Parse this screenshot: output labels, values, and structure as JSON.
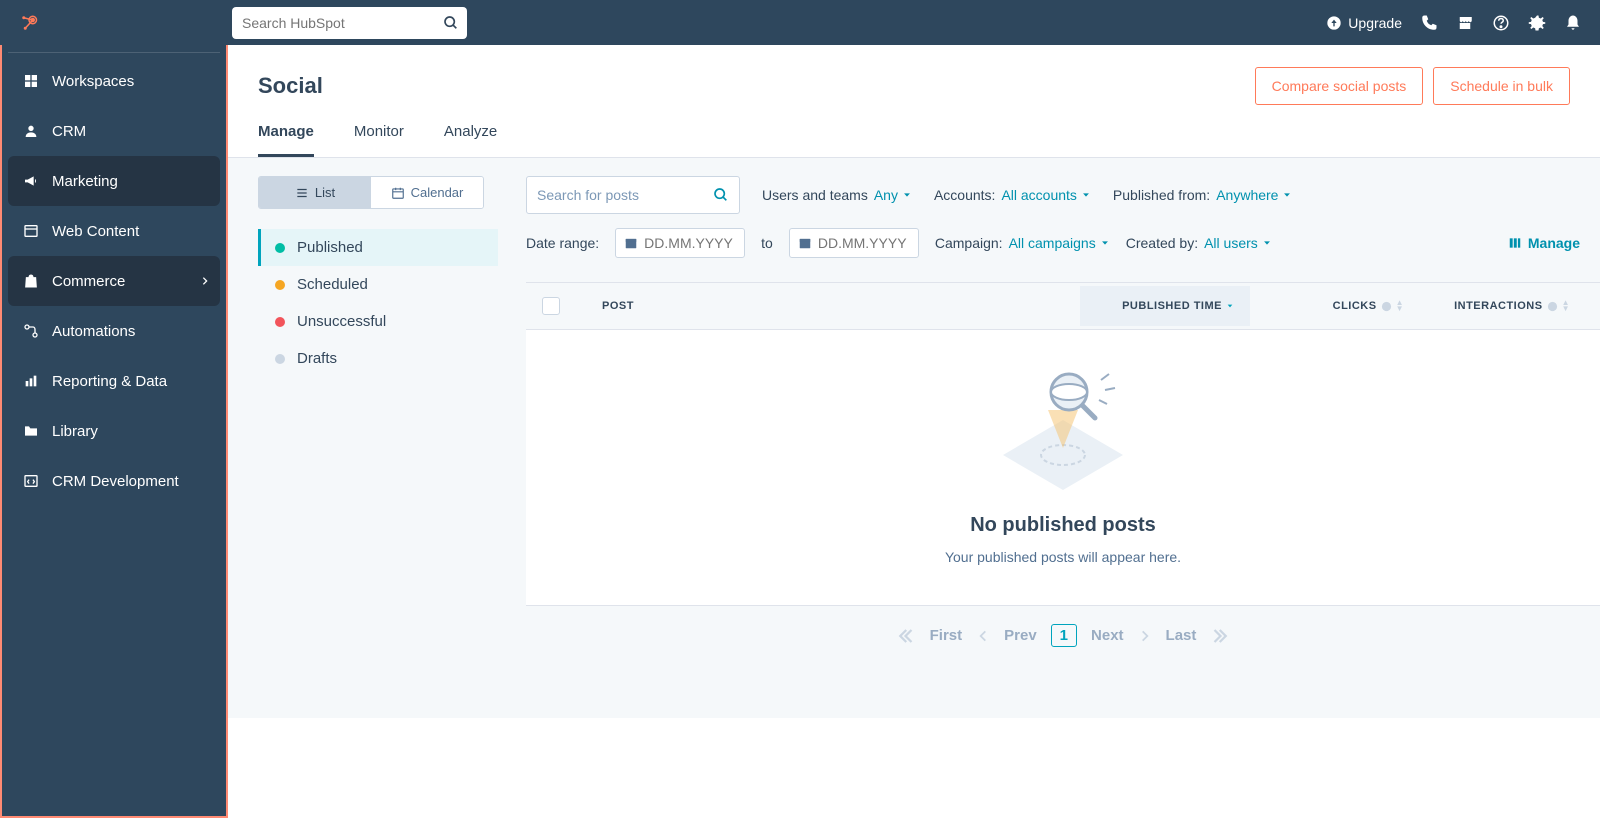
{
  "topbar": {
    "search_placeholder": "Search HubSpot",
    "upgrade_label": "Upgrade"
  },
  "sidebar": {
    "items": [
      {
        "label": "Workspaces"
      },
      {
        "label": "CRM"
      },
      {
        "label": "Marketing"
      },
      {
        "label": "Web Content"
      },
      {
        "label": "Commerce"
      },
      {
        "label": "Automations"
      },
      {
        "label": "Reporting & Data"
      },
      {
        "label": "Library"
      },
      {
        "label": "CRM Development"
      }
    ]
  },
  "page": {
    "title": "Social",
    "compare_btn": "Compare social posts",
    "schedule_btn": "Schedule in bulk"
  },
  "tabs": [
    {
      "label": "Manage"
    },
    {
      "label": "Monitor"
    },
    {
      "label": "Analyze"
    }
  ],
  "view_toggle": {
    "list": "List",
    "calendar": "Calendar"
  },
  "statuses": [
    {
      "label": "Published",
      "color": "#00bda5"
    },
    {
      "label": "Scheduled",
      "color": "#f5a623"
    },
    {
      "label": "Unsuccessful",
      "color": "#f2545b"
    },
    {
      "label": "Drafts",
      "color": "#cbd6e2"
    }
  ],
  "filters": {
    "post_search_placeholder": "Search for posts",
    "users_teams_label": "Users and teams",
    "users_teams_value": "Any",
    "accounts_label": "Accounts:",
    "accounts_value": "All accounts",
    "published_from_label": "Published from:",
    "published_from_value": "Anywhere",
    "date_range_label": "Date range:",
    "date_placeholder": "DD.MM.YYYY",
    "to_label": "to",
    "campaign_label": "Campaign:",
    "campaign_value": "All campaigns",
    "created_by_label": "Created by:",
    "created_by_value": "All users",
    "manage_link": "Manage"
  },
  "table": {
    "post_header": "POST",
    "published_time_header": "PUBLISHED TIME",
    "clicks_header": "CLICKS",
    "interactions_header": "INTERACTIONS"
  },
  "empty": {
    "heading": "No published posts",
    "sub": "Your published posts will appear here."
  },
  "pager": {
    "first": "First",
    "prev": "Prev",
    "current": "1",
    "next": "Next",
    "last": "Last"
  }
}
